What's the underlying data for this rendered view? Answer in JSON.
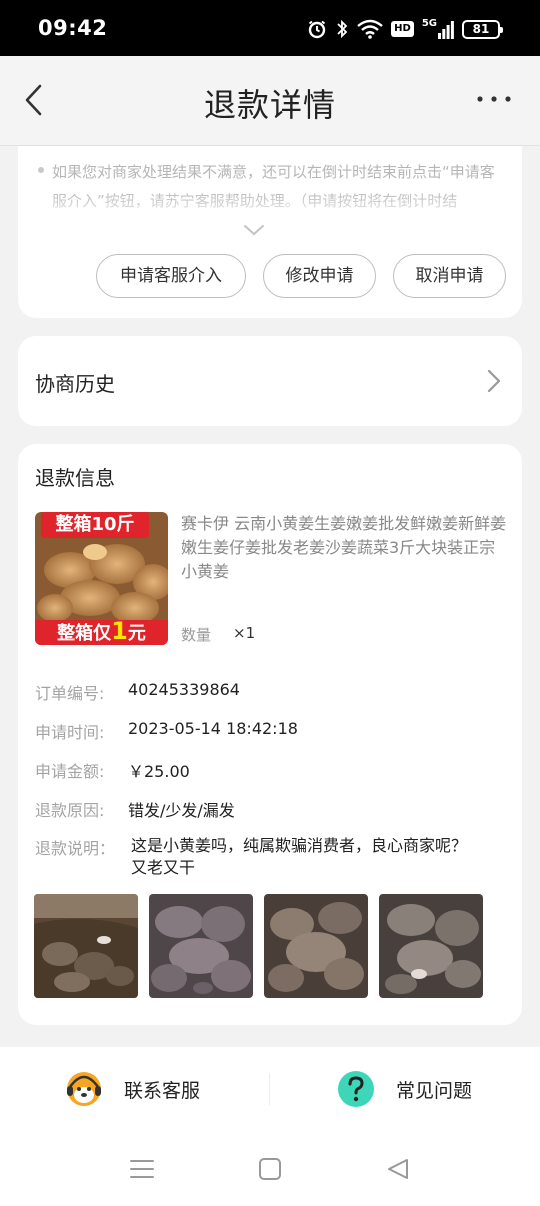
{
  "status_bar": {
    "time": "09:42",
    "network": "5G",
    "hd": "HD",
    "battery": "81",
    "icons": [
      "alarm-icon",
      "bluetooth-icon",
      "wifi-icon",
      "hd-icon",
      "signal-5g-icon",
      "battery-icon"
    ]
  },
  "header": {
    "title": "退款详情",
    "back_icon": "chevron-left-icon",
    "more_icon": "more-dots-icon"
  },
  "notice": {
    "text": "如果您对商家处理结果不满意，还可以在倒计时结束前点击“申请客服介入”按钮，请苏宁客服帮助处理。（申请按钮将在倒计时结",
    "expand_icon": "chevron-down-icon"
  },
  "actions": {
    "apply_service": "申请客服介入",
    "modify": "修改申请",
    "cancel": "取消申请"
  },
  "history": {
    "label": "协商历史",
    "arrow_icon": "chevron-right-icon"
  },
  "refund_info": {
    "title": "退款信息",
    "product": {
      "name": "赛卡伊 云南小黄姜生姜嫩姜批发鲜嫩姜新鲜姜嫩生姜仔姜批发老姜沙姜蔬菜3斤大块装正宗小黄姜",
      "image_banner_top": "整箱10斤",
      "image_banner_bottom_prefix": "整箱仅",
      "image_banner_bottom_number": "1",
      "image_banner_bottom_suffix": "元",
      "quantity_label": "数量",
      "quantity_value": "×1"
    },
    "rows": {
      "order_label": "订单编号:",
      "order_value": "40245339864",
      "time_label": "申请时间:",
      "time_value": "2023-05-14 18:42:18",
      "amount_label": "申请金额:",
      "amount_value": "￥25.00",
      "reason_label": "退款原因:",
      "reason_value": "错发/少发/漏发",
      "desc_label": "退款说明：",
      "desc_value": "这是小黄姜吗，纯属欺骗消费者，良心商家呢？又老又干"
    }
  },
  "bottom_bar": {
    "contact_label": "联系客服",
    "contact_icon": "customer-service-avatar-icon",
    "faq_label": "常见问题",
    "faq_icon": "question-icon"
  },
  "nav_bar": {
    "icons": [
      "menu-icon",
      "home-icon",
      "back-triangle-icon"
    ]
  },
  "colors": {
    "faq_icon": "#3ed6b8",
    "banner_red": "#e0242b",
    "banner_yellow": "#ffe400"
  }
}
